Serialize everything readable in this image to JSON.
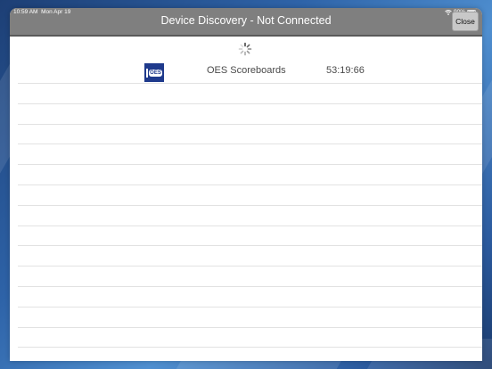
{
  "status_bar": {
    "time": "10:59 AM",
    "date": "Mon Apr 19",
    "battery": "90%"
  },
  "header": {
    "title": "Device Discovery - Not Connected",
    "close_label": "Close"
  },
  "devices": [
    {
      "logo_text": "OES",
      "name": "OES Scoreboards",
      "id": "53:19:66"
    }
  ],
  "colors": {
    "titlebar": "#7f7f7f",
    "logo": "#1f3a8c",
    "background": "#2e63a8"
  }
}
